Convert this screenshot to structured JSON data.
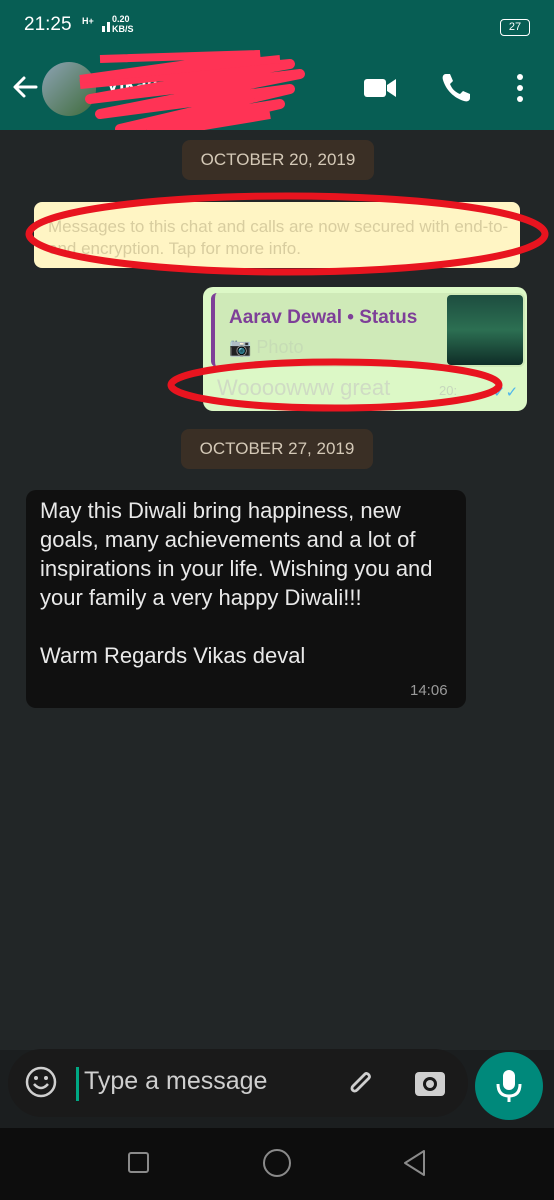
{
  "status_bar": {
    "time": "21:25",
    "network": "H+",
    "speed_value": "0.20",
    "speed_unit": "KB/S",
    "battery": "27"
  },
  "header": {
    "contact_name": "Vikas deval"
  },
  "chat": {
    "date_1": "OCTOBER 20, 2019",
    "encryption_notice": "Messages to this chat and calls are now secured with end-to-end encryption. Tap for more info.",
    "outgoing": {
      "quote_name": "Aarav Dewal • Status",
      "quote_sub": "Photo",
      "text": "Woooowww great",
      "time": "20:"
    },
    "date_2": "OCTOBER 27, 2019",
    "incoming": {
      "text_1": "May this Diwali bring happiness, new goals, many achievements and a lot of inspirations in your life. Wishing you and your family a very happy Diwali!!!",
      "text_2": "Warm Regards Vikas deval",
      "time": "14:06"
    }
  },
  "input": {
    "placeholder": "Type a message"
  },
  "colors": {
    "header": "#075e54",
    "accent": "#00897b",
    "outgoing_bubble": "#dcf8c6",
    "incoming_bubble": "#101010"
  }
}
